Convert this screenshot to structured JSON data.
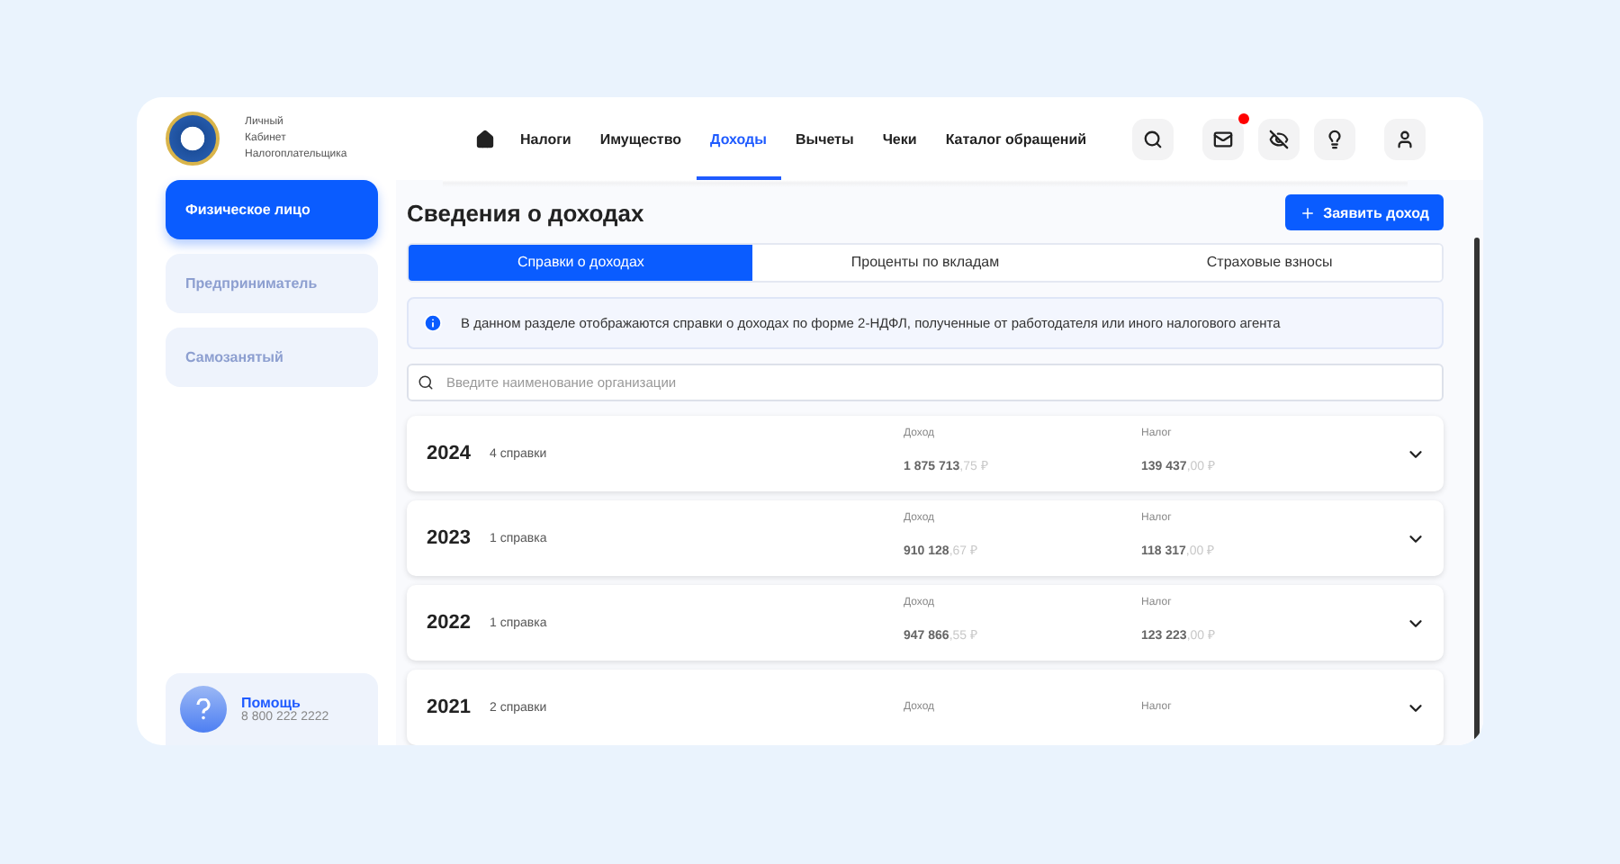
{
  "logo": {
    "lines": [
      "Личный",
      "Кабинет",
      "Налогоплательщика"
    ]
  },
  "nav": [
    {
      "label": "Налоги",
      "selected": false
    },
    {
      "label": "Имущество",
      "selected": false
    },
    {
      "label": "Доходы",
      "selected": true
    },
    {
      "label": "Вычеты",
      "selected": false
    },
    {
      "label": "Чеки",
      "selected": false
    },
    {
      "label": "Каталог обращений",
      "selected": false
    }
  ],
  "header_icons": [
    {
      "kind": "search",
      "badge": false
    },
    {
      "kind": "mail",
      "badge": true
    },
    {
      "kind": "eye-off",
      "badge": false
    },
    {
      "kind": "bulb",
      "badge": false
    },
    {
      "kind": "user",
      "badge": false
    }
  ],
  "sidebar": {
    "items": [
      {
        "label": "Физическое лицо",
        "selected": true
      },
      {
        "label": "Предприниматель",
        "selected": false
      },
      {
        "label": "Самозанятый",
        "selected": false
      }
    ],
    "help": {
      "title": "Помощь",
      "phone": "8 800 222 2222"
    }
  },
  "page": {
    "title": "Сведения о доходах",
    "action": "Заявить доход",
    "tabs": [
      {
        "label": "Справки о доходах",
        "selected": true
      },
      {
        "label": "Проценты по вкладам",
        "selected": false
      },
      {
        "label": "Страховые взносы",
        "selected": false
      }
    ],
    "info": "В данном разделе отображаются справки о доходах по форме 2-НДФЛ, полученные от работодателя или иного налогового агента",
    "search": {
      "placeholder": "Введите наименование организации"
    },
    "years": [
      {
        "year": "2024",
        "count": "4 справки",
        "income_label": "Доход",
        "income": "1 875 713",
        "income_cents": ",75 ₽",
        "tax_label": "Налог",
        "tax": "139 437",
        "tax_cents": ",00 ₽"
      },
      {
        "year": "2023",
        "count": "1 справка",
        "income_label": "Доход",
        "income": "910 128",
        "income_cents": ",67 ₽",
        "tax_label": "Налог",
        "tax": "118 317",
        "tax_cents": ",00 ₽"
      },
      {
        "year": "2022",
        "count": "1 справка",
        "income_label": "Доход",
        "income": "947 866",
        "income_cents": ",55 ₽",
        "tax_label": "Налог",
        "tax": "123 223",
        "tax_cents": ",00 ₽"
      },
      {
        "year": "2021",
        "count": "2 справки",
        "income_label": "Доход",
        "tax_label": "Налог"
      }
    ]
  }
}
